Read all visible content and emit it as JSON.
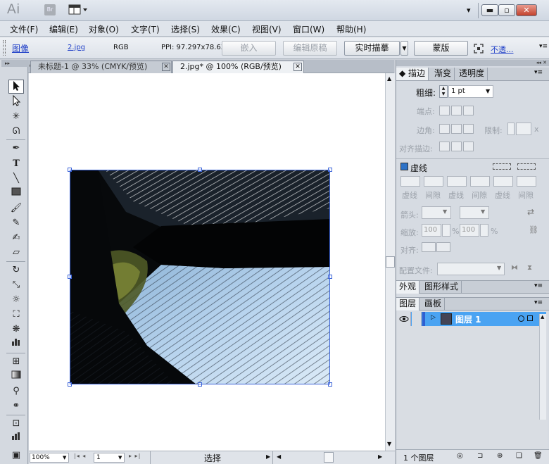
{
  "app": {
    "logo": "Ai",
    "bridge": "Br"
  },
  "window_buttons": {
    "minimize": "▬",
    "restore": "▫",
    "close": "✕",
    "dropdown": "▾"
  },
  "menu": [
    "文件(F)",
    "编辑(E)",
    "对象(O)",
    "文字(T)",
    "选择(S)",
    "效果(C)",
    "视图(V)",
    "窗口(W)",
    "帮助(H)"
  ],
  "control": {
    "type": "图像",
    "file": "2.jpg",
    "mode": "RGB",
    "ppi": "PPI: 97.297x78.63",
    "embed": "嵌入",
    "edit_original": "编辑原稿",
    "live_trace": "实时描摹",
    "mask": "蒙版",
    "opacity": "不透..."
  },
  "tabs": [
    {
      "label": "未标题-1 @ 33% (CMYK/预览)",
      "active": false
    },
    {
      "label": "2.jpg* @ 100% (RGB/预览)",
      "active": true
    }
  ],
  "tools": [
    "selection-icon",
    "direct-selection-icon",
    "magic-wand-icon",
    "lasso-icon",
    "pen-icon",
    "type-icon",
    "line-icon",
    "rectangle-icon",
    "paintbrush-icon",
    "pencil-icon",
    "blob-brush-icon",
    "eraser-icon",
    "rotate-icon",
    "scale-icon",
    "warp-icon",
    "free-transform-icon",
    "symbol-sprayer-icon",
    "graph-icon",
    "mesh-icon",
    "gradient-icon",
    "eyedropper-icon",
    "blend-icon",
    "slice-icon",
    "zoom-icon"
  ],
  "stroke_panel": {
    "tabs": [
      "描边",
      "渐变",
      "透明度"
    ],
    "weight_label": "粗细:",
    "weight_value": "1 pt",
    "cap_label": "端点:",
    "corner_label": "边角:",
    "limit_label": "限制:",
    "limit_suffix": "x",
    "align_label": "对齐描边:",
    "dashed_label": "虚线",
    "dash_labels": [
      "虚线",
      "间隙",
      "虚线",
      "间隙",
      "虚线",
      "间隙"
    ],
    "arrow_label": "箭头:",
    "scale_label": "缩放:",
    "scale_value1": "100",
    "scale_value2": "100",
    "percent": "%",
    "align2_label": "对齐:",
    "profile_label": "配置文件:"
  },
  "appearance_panel": {
    "tabs": [
      "外观",
      "图形样式"
    ]
  },
  "layers_panel": {
    "tabs": [
      "图层",
      "画板"
    ],
    "layer_name": "图层 1",
    "count": "1 个图层"
  },
  "status": {
    "zoom": "100%",
    "artboard": "1",
    "mode": "选择"
  },
  "colors": {
    "selection": "#3b63d8",
    "layer_highlight": "#4aa3f2"
  }
}
